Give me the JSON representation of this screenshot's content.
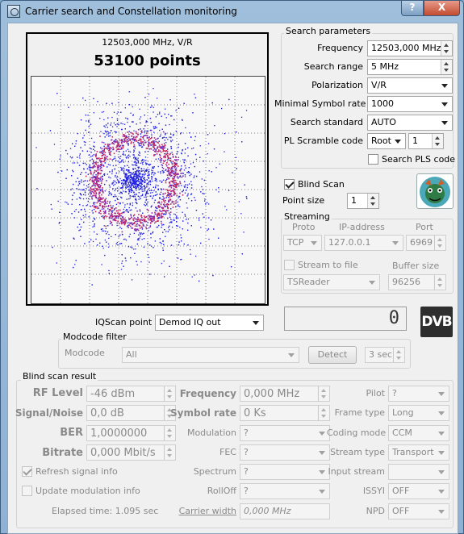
{
  "window": {
    "title": "Carrier search and Constellation monitoring",
    "help_glyph": "?",
    "close_glyph": "X"
  },
  "constellation": {
    "freq_pol": "12503,000 MHz, V/R",
    "points": "53100 points"
  },
  "search_params": {
    "title": "Search parameters",
    "frequency_label": "Frequency",
    "frequency_value": "12503,000 MHz",
    "search_range_label": "Search range",
    "search_range_value": "5 MHz",
    "polarization_label": "Polarization",
    "polarization_value": "V/R",
    "min_symbol_rate_label": "Minimal Symbol rate",
    "min_symbol_rate_value": "1000",
    "search_standard_label": "Search standard",
    "search_standard_value": "AUTO",
    "pl_scramble_label": "PL Scramble code",
    "pl_scramble_type": "Root",
    "pl_scramble_value": "1",
    "search_pls_label": "Search PLS code"
  },
  "blind_scan": {
    "label": "Blind Scan",
    "checked": true
  },
  "point_size": {
    "label": "Point size",
    "value": "1"
  },
  "streaming": {
    "title": "Streaming",
    "proto_header": "Proto",
    "ip_header": "IP-address",
    "port_header": "Port",
    "proto_value": "TCP",
    "ip_value": "127.0.0.1",
    "port_value": "6969",
    "stream_to_file_label": "Stream to file",
    "buffer_size_label": "Buffer size",
    "format_value": "TSReader",
    "buffer_size_value": "96256"
  },
  "iqscan": {
    "label": "IQScan point",
    "value": "Demod IQ out"
  },
  "lcd_value": "0",
  "dvb_logo": "DVB",
  "modcode_filter": {
    "title": "Modcode filter",
    "modcode_label": "Modcode",
    "modcode_value": "All",
    "detect_label": "Detect",
    "timeout_value": "3 sec"
  },
  "result": {
    "title": "Blind scan result",
    "rf_level_label": "RF Level",
    "rf_level_value": "-46 dBm",
    "signal_noise_label": "Signal/Noise",
    "signal_noise_value": "0,0 dB",
    "ber_label": "BER",
    "ber_value": "1,0000000",
    "bitrate_label": "Bitrate",
    "bitrate_value": "0,000 Mbit/s",
    "frequency_label": "Frequency",
    "frequency_value": "0,000 MHz",
    "symbol_rate_label": "Symbol rate",
    "symbol_rate_value": "0 Ks",
    "modulation_label": "Modulation",
    "modulation_value": "?",
    "fec_label": "FEC",
    "fec_value": "?",
    "spectrum_label": "Spectrum",
    "spectrum_value": "?",
    "rolloff_label": "RollOff",
    "rolloff_value": "?",
    "carrier_width_label": "Carrier width",
    "carrier_width_value": "0,000 MHz",
    "pilot_label": "Pilot",
    "pilot_value": "?",
    "frame_type_label": "Frame type",
    "frame_type_value": "Long",
    "coding_mode_label": "Coding mode",
    "coding_mode_value": "CCM",
    "stream_type_label": "Stream type",
    "stream_type_value": "Transport",
    "input_stream_label": "Input stream",
    "input_stream_value": "",
    "issyi_label": "ISSYI",
    "issyi_value": "OFF",
    "npd_label": "NPD",
    "npd_value": "OFF",
    "refresh_signal_label": "Refresh signal info",
    "refresh_signal_checked": true,
    "update_modulation_label": "Update modulation info",
    "update_modulation_checked": false,
    "elapsed_time": "Elapsed time: 1.095 sec"
  }
}
